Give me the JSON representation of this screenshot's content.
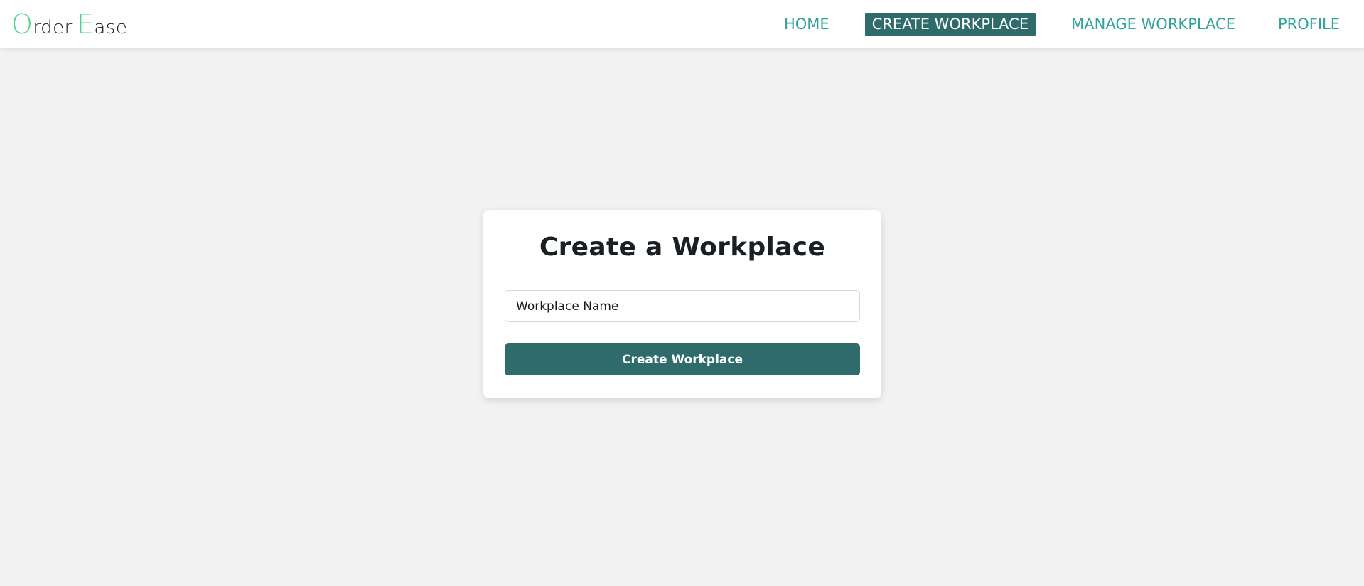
{
  "colors": {
    "accent_teal": "#2e6b6a",
    "nav_link_teal": "#35a29a",
    "logo_green": "#4fd18f",
    "page_bg": "#f2f2f2"
  },
  "header": {
    "logo": {
      "first_letter": "O",
      "first_rest": "rder",
      "second_letter": "E",
      "second_rest": "ase"
    },
    "nav": [
      {
        "label": "HOME",
        "active": false
      },
      {
        "label": "CREATE WORKPLACE",
        "active": true
      },
      {
        "label": "MANAGE WORKPLACE",
        "active": false
      },
      {
        "label": "PROFILE",
        "active": false
      }
    ]
  },
  "form": {
    "title": "Create a Workplace",
    "name_input": {
      "placeholder": "Workplace Name",
      "value": ""
    },
    "submit_label": "Create Workplace"
  }
}
